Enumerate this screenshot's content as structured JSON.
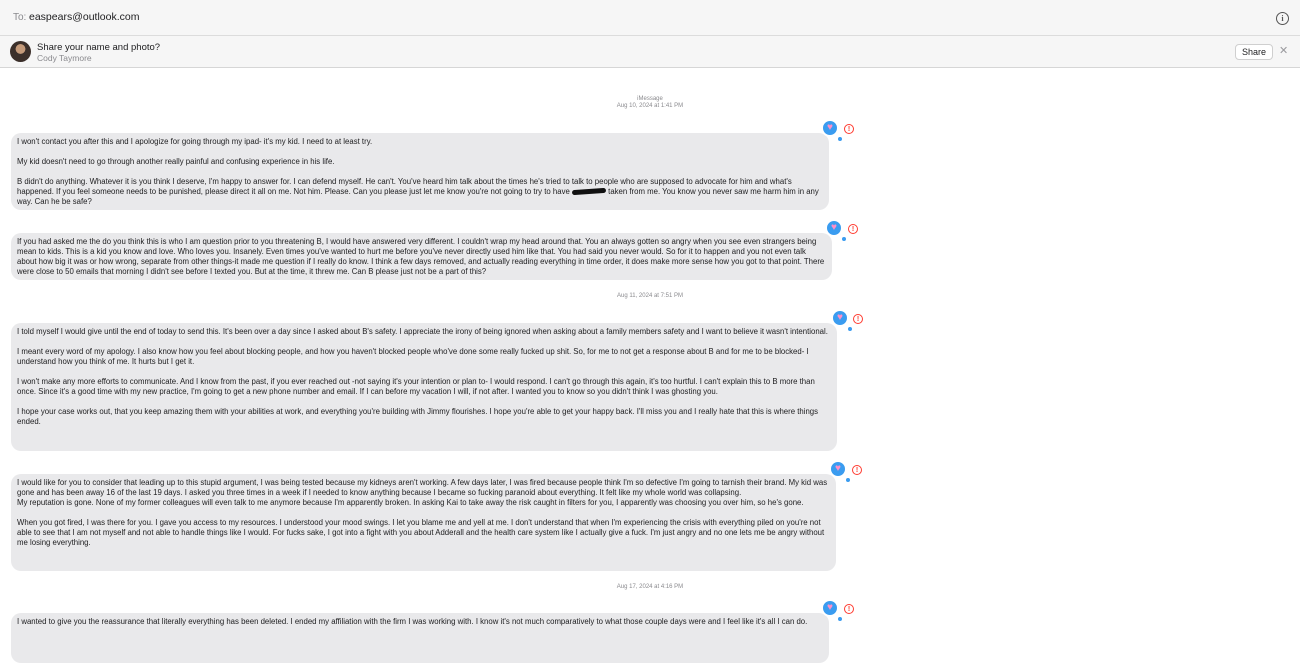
{
  "header": {
    "to_label": "To:",
    "to_value": "easpears@outlook.com",
    "info_icon": "info-icon"
  },
  "share_bar": {
    "title": "Share your name and photo?",
    "subtitle": "Cody Taymore",
    "share_label": "Share",
    "close_icon": "close-icon"
  },
  "conversation": {
    "service": "iMessage",
    "timestamps": [
      "Aug 10, 2024 at 1:41 PM",
      "Aug 11, 2024 at 7:51 PM",
      "Aug 17, 2024 at 4:16 PM"
    ],
    "messages": [
      {
        "paragraphs": [
          "I won't contact you after this and I apologize for going through my ipad- it's my kid. I need to at least try.",
          "My kid doesn't need to go through another really painful and confusing experience in his life.",
          "B didn't do anything. Whatever it is you think I deserve, I'm happy to answer for. I can defend myself. He can't. You've heard him talk about the times he's tried to talk to people who are supposed to advocate for him and what's happened. If you feel someone needs to be punished, please direct it all on me. Not him. Please. Can you please just let me know you're not going to try to have",
          "taken from me. You know you never saw me harm him in any way. Can he be safe?"
        ]
      },
      {
        "paragraphs": [
          "If you had asked me the do you think this is who I am question prior to you threatening B, I would have answered very different. I couldn't wrap my head around that.  You an always gotten so angry when you see even strangers being mean to kids. This is a kid you know and love. Who loves you. Insanely. Even times you've wanted to hurt me before you've never directly used him like that. You had said you never would. So for it to happen and you not even talk about how big it was or how wrong, separate from other things-it made me question if I really do know. I think a few days removed, and actually reading everything in time order, it does make more sense how you got to that point. There were close to 50 emails that morning I didn't see before I texted you. But at the time, it threw me. Can B please just not be a part of this?"
        ]
      },
      {
        "paragraphs": [
          "I told myself I would give until the end of today to send this. It's been over a day since I asked about B's safety. I appreciate the irony of being ignored when asking about a family members safety and I want to believe it wasn't intentional.",
          "I meant every word of my apology. I also know how you feel about blocking people, and how you haven't blocked people who've done some really fucked up shit. So, for me to not get a response about B and for me to be blocked- I understand how you think of me. It hurts but I get it.",
          "I won't make any more efforts to communicate. And I know from the past, if you ever reached out -not saying it's your intention or plan to- I would respond. I can't go through this again, it's too hurtful. I can't explain this to B more than once. Since it's a good time with my new practice, I'm going to get a new phone number and email. If I can before my vacation I will, if not after. I wanted you to know so you didn't think I was ghosting you.",
          "I hope your case works out, that you keep amazing them with your abilities at work, and everything you're building with Jimmy flourishes. I hope you're able to get your happy back. I'll miss you and I really hate that this is where things ended."
        ]
      },
      {
        "paragraphs": [
          "I would like for you to consider that leading up to this stupid argument, I was being tested because my kidneys aren't working. A few days later, I was fired because people think I'm so defective I'm going to tarnish their brand. My kid was gone and has been away 16 of the last 19 days. I asked you three times in a week if I needed to know anything because I became so fucking paranoid about everything. It felt like my whole world was collapsing.",
          "My reputation is gone. None of my former colleagues will even talk to me anymore because I'm apparently broken. In asking Kai to take away the risk caught in filters for you, I apparently was choosing you over him, so he's gone.",
          "When you got fired, I was there for you. I gave you access to my resources. I understood your mood swings. I let you blame me and yell at me. I don't understand that when I'm experiencing the crisis with everything piled on you're not able to see that I am not myself and not able to handle things like I would. For fucks sake, I got into a fight with you about Adderall and the health care system like I actually give a fuck. I'm just angry and no one lets me be angry without me losing everything."
        ]
      },
      {
        "paragraphs": [
          "I wanted to give you the reassurance that literally everything has been deleted. I ended my affiliation with the firm I was working with. I know it's not much comparatively to what those couple days were and I feel like it's all I can do."
        ]
      }
    ],
    "tapback_icon": "heart-tapback-icon",
    "error_icon": "not-delivered-icon"
  }
}
